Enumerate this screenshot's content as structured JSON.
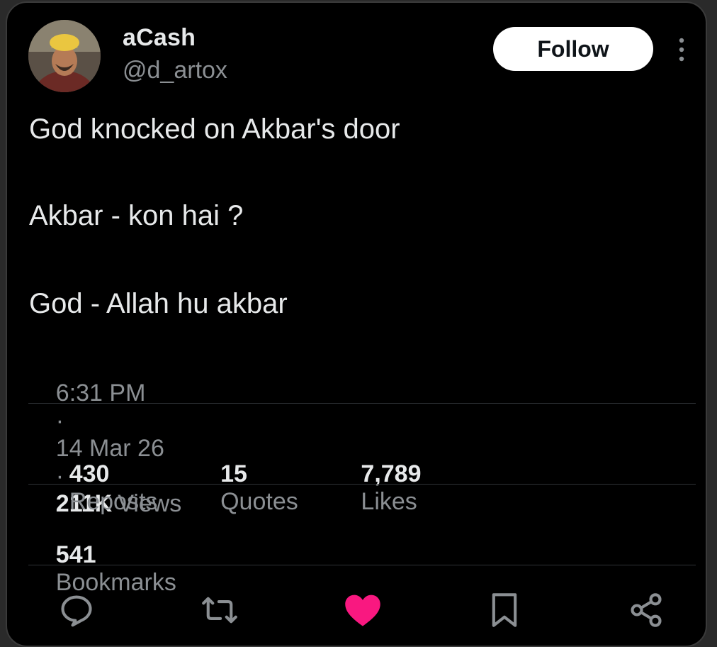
{
  "author": {
    "display_name": "aCash",
    "handle": "@d_artox",
    "avatar_icon": "profile-photo"
  },
  "follow_button": {
    "label": "Follow"
  },
  "more_icon": "more-vertical-icon",
  "tweet": {
    "lines": [
      "God knocked on Akbar's door",
      "Akbar - kon hai ?",
      "God - Allah hu akbar"
    ]
  },
  "meta": {
    "time": "6:31 PM",
    "separator": "·",
    "date": "14 Mar 26",
    "views_count": "211K",
    "views_label": "Views"
  },
  "stats": {
    "reposts": {
      "count": "430",
      "label": "Reposts"
    },
    "quotes": {
      "count": "15",
      "label": "Quotes"
    },
    "likes": {
      "count": "7,789",
      "label": "Likes"
    },
    "bookmarks": {
      "count": "541",
      "label": "Bookmarks"
    }
  },
  "actions": [
    {
      "icon": "reply-icon"
    },
    {
      "icon": "repost-icon"
    },
    {
      "icon": "like-icon",
      "active": true
    },
    {
      "icon": "bookmark-icon"
    },
    {
      "icon": "share-icon"
    }
  ],
  "colors": {
    "background": "#000000",
    "text_primary": "#e7e9ea",
    "text_secondary": "#8b8f93",
    "like_active": "#f91880",
    "follow_bg": "#ffffff"
  }
}
